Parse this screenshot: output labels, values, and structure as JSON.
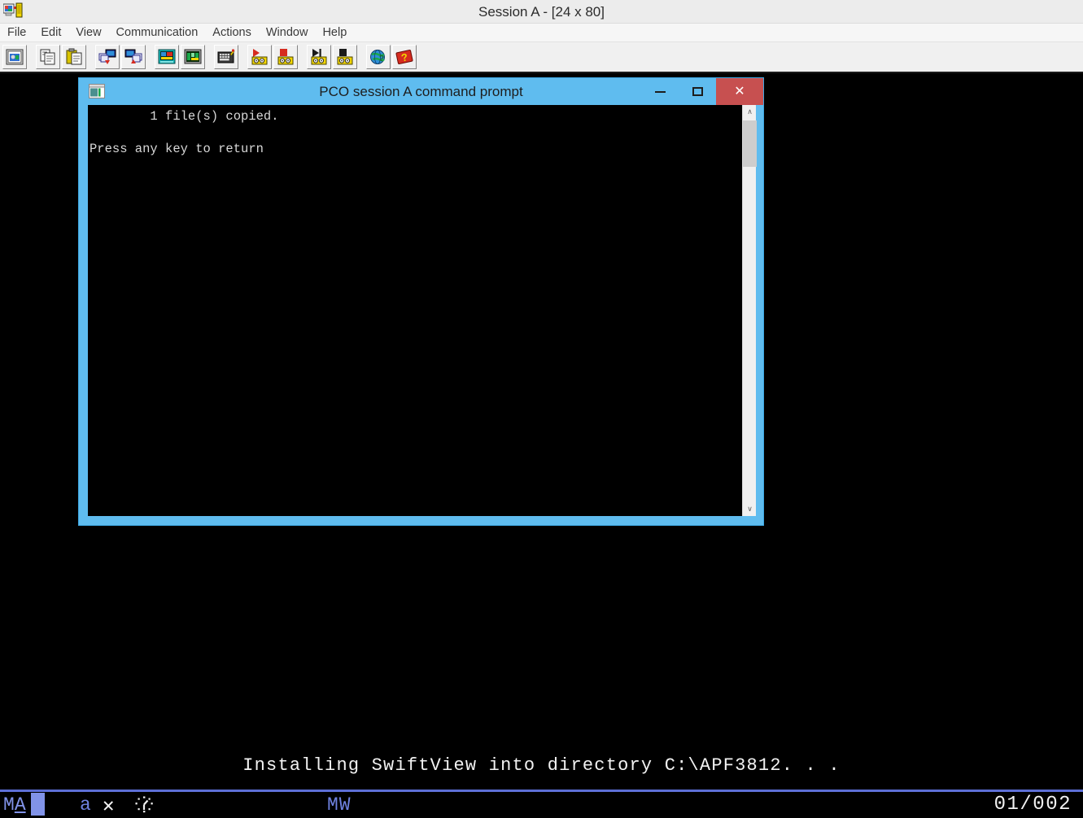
{
  "window": {
    "title": "Session A - [24 x 80]",
    "app_icon": "pcomm-session-icon"
  },
  "menubar": {
    "items": [
      {
        "label": "File"
      },
      {
        "label": "Edit"
      },
      {
        "label": "View"
      },
      {
        "label": "Communication"
      },
      {
        "label": "Actions"
      },
      {
        "label": "Window"
      },
      {
        "label": "Help"
      }
    ]
  },
  "toolbar": {
    "groups": [
      {
        "buttons": [
          {
            "name": "screen-capture-icon",
            "tip": "Display screen"
          }
        ]
      },
      {
        "buttons": [
          {
            "name": "copy-icon",
            "tip": "Copy"
          },
          {
            "name": "paste-icon",
            "tip": "Paste"
          }
        ]
      },
      {
        "buttons": [
          {
            "name": "send-file-icon",
            "tip": "Send file to host"
          },
          {
            "name": "receive-file-icon",
            "tip": "Receive file from host"
          }
        ]
      },
      {
        "buttons": [
          {
            "name": "color-settings-icon",
            "tip": "Color settings"
          },
          {
            "name": "screen-settings-icon",
            "tip": "Screen settings"
          }
        ]
      },
      {
        "buttons": [
          {
            "name": "keyboard-setup-icon",
            "tip": "Keyboard setup"
          }
        ]
      },
      {
        "buttons": [
          {
            "name": "record-macro-icon",
            "tip": "Record macro"
          },
          {
            "name": "stop-recording-icon",
            "tip": "Stop recording"
          }
        ]
      },
      {
        "buttons": [
          {
            "name": "play-macro-icon",
            "tip": "Play macro"
          },
          {
            "name": "stop-macro-icon",
            "tip": "Stop macro"
          }
        ]
      },
      {
        "buttons": [
          {
            "name": "globe-support-icon",
            "tip": "Support"
          },
          {
            "name": "help-index-icon",
            "tip": "Help index"
          }
        ]
      }
    ]
  },
  "inner_window": {
    "title": "PCO session A command prompt",
    "icon": "console-window-icon",
    "controls": {
      "minimize": "–",
      "maximize": "□",
      "close": "✕"
    },
    "console_lines": [
      "        1 file(s) copied.",
      "",
      "Press any key to return"
    ],
    "scrollbar": {
      "up_arrow": "∧",
      "down_arrow": "∨"
    }
  },
  "terminal": {
    "message": "Installing SwiftView into directory C:\\APF3812. . ."
  },
  "status_bar": {
    "mode_prefix": "M",
    "mode_letter": "A",
    "insert_indicator": "a",
    "x_indicator": "✕",
    "clock_icon": "clock-wait-icon",
    "message_wait": "MW",
    "cursor_position": "01/002"
  },
  "colors": {
    "inner_window_frame": "#5fbcef",
    "close_button": "#c75050",
    "toolbar_bg": "#f0f0f0",
    "titlebar_bg": "#ececec",
    "terminal_bg": "#000000",
    "oia_blue": "#8193e8",
    "oia_rule": "#5d6fd6"
  }
}
